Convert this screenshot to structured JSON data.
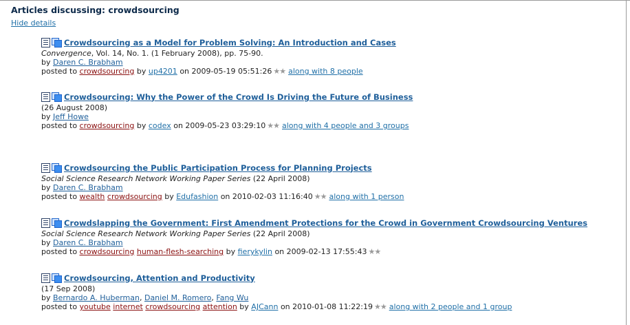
{
  "page": {
    "heading": "Articles discussing: crowdsourcing",
    "hide_details": "Hide details"
  },
  "labels": {
    "by": "by",
    "posted_to": "posted to",
    "on": "on"
  },
  "articles": [
    {
      "title": "Crowdsourcing as a Model for Problem Solving: An Introduction and Cases",
      "journal": "Convergence",
      "citation": ", Vol. 14, No. 1. (1 February 2008), pp. 75-90.",
      "authors": [
        "Daren C. Brabham"
      ],
      "tags": [
        "crowdsourcing"
      ],
      "poster": "up4201",
      "timestamp": "2009-05-19 05:51:26",
      "stars": "★★",
      "along": "along with 8 people"
    },
    {
      "title": "Crowdsourcing: Why the Power of the Crowd Is Driving the Future of Business",
      "journal": "",
      "citation": "(26 August 2008)",
      "authors": [
        "Jeff Howe"
      ],
      "tags": [
        "crowdsourcing"
      ],
      "poster": "codex",
      "timestamp": "2009-05-23 03:29:10",
      "stars": "★★",
      "along": "along with 4 people and 3 groups"
    },
    {
      "title": "Crowdsourcing the Public Participation Process for Planning Projects",
      "journal": "Social Science Research Network Working Paper Series",
      "citation": " (22 April 2008)",
      "authors": [
        "Daren C. Brabham"
      ],
      "tags": [
        "wealth",
        "crowdsourcing"
      ],
      "poster": "Edufashion",
      "timestamp": "2010-02-03 11:16:40",
      "stars": "★★",
      "along": "along with 1 person"
    },
    {
      "title": "Crowdslapping the Government: First Amendment Protections for the Crowd in Government Crowdsourcing Ventures",
      "journal": "Social Science Research Network Working Paper Series",
      "citation": " (22 April 2008)",
      "authors": [
        "Daren C. Brabham"
      ],
      "tags": [
        "crowdsourcing",
        "human-flesh-searching"
      ],
      "poster": "fierykylin",
      "timestamp": "2009-02-13 17:55:43",
      "stars": "★★",
      "along": ""
    },
    {
      "title": "Crowdsourcing, Attention and Productivity",
      "journal": "",
      "citation": "(17 Sep 2008)",
      "authors": [
        "Bernardo A. Huberman",
        "Daniel M. Romero",
        "Fang Wu"
      ],
      "tags": [
        "youtube",
        "internet",
        "crowdsourcing",
        "attention"
      ],
      "poster": "AJCann",
      "timestamp": "2010-01-08 11:22:19",
      "stars": "★★",
      "along": "along with 2 people and 1 group"
    }
  ]
}
